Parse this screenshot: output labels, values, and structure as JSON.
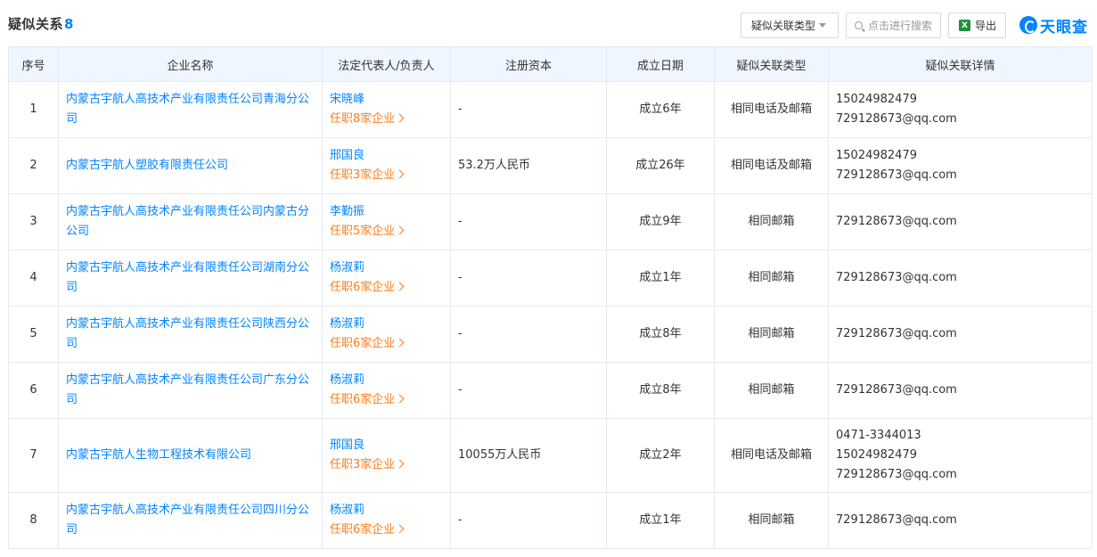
{
  "header": {
    "title": "疑似关系",
    "count": "8",
    "type_filter_label": "疑似关联类型",
    "search_placeholder": "点击进行搜索",
    "export_label": "导出",
    "logo_text": "天眼查",
    "accent_color": "#0084ff"
  },
  "table": {
    "columns": [
      "序号",
      "企业名称",
      "法定代表人/负责人",
      "注册资本",
      "成立日期",
      "疑似关联类型",
      "疑似关联详情"
    ],
    "rows": [
      {
        "no": "1",
        "company": "内蒙古宇航人高技术产业有限责任公司青海分公司",
        "rep": "宋晓峰",
        "rep_roles": "任职8家企业",
        "capital": "-",
        "founded": "成立6年",
        "type": "相同电话及邮箱",
        "details": [
          "15024982479",
          "729128673@qq.com"
        ]
      },
      {
        "no": "2",
        "company": "内蒙古宇航人塑胶有限责任公司",
        "rep": "邢国良",
        "rep_roles": "任职3家企业",
        "capital": "53.2万人民币",
        "founded": "成立26年",
        "type": "相同电话及邮箱",
        "details": [
          "15024982479",
          "729128673@qq.com"
        ]
      },
      {
        "no": "3",
        "company": "内蒙古宇航人高技术产业有限责任公司内蒙古分公司",
        "rep": "李勤振",
        "rep_roles": "任职5家企业",
        "capital": "-",
        "founded": "成立9年",
        "type": "相同邮箱",
        "details": [
          "729128673@qq.com"
        ]
      },
      {
        "no": "4",
        "company": "内蒙古宇航人高技术产业有限责任公司湖南分公司",
        "rep": "杨淑莉",
        "rep_roles": "任职6家企业",
        "capital": "-",
        "founded": "成立1年",
        "type": "相同邮箱",
        "details": [
          "729128673@qq.com"
        ]
      },
      {
        "no": "5",
        "company": "内蒙古宇航人高技术产业有限责任公司陕西分公司",
        "rep": "杨淑莉",
        "rep_roles": "任职6家企业",
        "capital": "-",
        "founded": "成立8年",
        "type": "相同邮箱",
        "details": [
          "729128673@qq.com"
        ]
      },
      {
        "no": "6",
        "company": "内蒙古宇航人高技术产业有限责任公司广东分公司",
        "rep": "杨淑莉",
        "rep_roles": "任职6家企业",
        "capital": "-",
        "founded": "成立8年",
        "type": "相同邮箱",
        "details": [
          "729128673@qq.com"
        ]
      },
      {
        "no": "7",
        "company": "内蒙古宇航人生物工程技术有限公司",
        "rep": "邢国良",
        "rep_roles": "任职3家企业",
        "capital": "10055万人民币",
        "founded": "成立2年",
        "type": "相同电话及邮箱",
        "details": [
          "0471-3344013",
          "15024982479",
          "729128673@qq.com"
        ]
      },
      {
        "no": "8",
        "company": "内蒙古宇航人高技术产业有限责任公司四川分公司",
        "rep": "杨淑莉",
        "rep_roles": "任职6家企业",
        "capital": "-",
        "founded": "成立1年",
        "type": "相同邮箱",
        "details": [
          "729128673@qq.com"
        ]
      }
    ]
  }
}
